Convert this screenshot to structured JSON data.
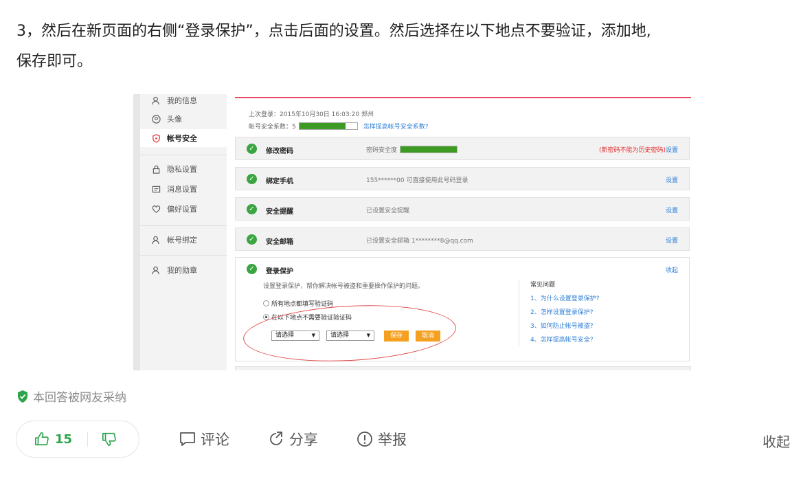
{
  "answer": {
    "line1": "3，然后在新页面的右侧“登录保护”，点击后面的设置。然后选择在以下地点不要验证，添加地,",
    "line2": "保存即可。"
  },
  "screenshot": {
    "sidebar": {
      "items": [
        {
          "label": "我的信息",
          "icon": "user-icon"
        },
        {
          "label": "头像",
          "icon": "avatar-icon"
        },
        {
          "label": "帐号安全",
          "icon": "shield-icon",
          "active": true
        },
        {
          "label": "隐私设置",
          "icon": "lock-icon"
        },
        {
          "label": "消息设置",
          "icon": "message-icon"
        },
        {
          "label": "偏好设置",
          "icon": "heart-icon"
        },
        {
          "label": "帐号绑定",
          "icon": "user-bind-icon"
        },
        {
          "label": "我的勋章",
          "icon": "medal-icon"
        }
      ]
    },
    "last_login": "上次登录：2015年10月30日  16:03:20  郑州",
    "security_label": "帐号安全系数：5",
    "security_level": 0.8,
    "security_link": "怎样提高帐号安全系数?",
    "rows": [
      {
        "name": "修改密码",
        "desc": "密码安全度",
        "warn": "(新密码不能为历史密码)",
        "action": "设置"
      },
      {
        "name": "绑定手机",
        "desc": "155******00 可直接使用此号码登录",
        "action": "设置"
      },
      {
        "name": "安全提醒",
        "desc": "已设置安全提醒",
        "action": "设置"
      },
      {
        "name": "安全邮箱",
        "desc": "已设置安全邮箱 1********8@qq.com",
        "action": "设置"
      }
    ],
    "login_protect": {
      "name": "登录保护",
      "collapse": "收起",
      "desc": "设置登录保护，帮你解决帐号被盗和重要操作保护的问题。",
      "radio1": "所有地点都填写验证码",
      "radio2": "在以下地点不需要验证验证码",
      "select1": "请选择",
      "select2": "请选择",
      "save": "保存",
      "cancel": "取消",
      "faq_title": "常见问题",
      "faq": [
        "1、为什么设置登录保护?",
        "2、怎样设置登录保护?",
        "3、如何防止帐号被盗?",
        "4、怎样提高帐号安全?"
      ]
    }
  },
  "adopted": "本回答被网友采纳",
  "vote": {
    "count": "15"
  },
  "actions": {
    "comment": "评论",
    "share": "分享",
    "report": "举报",
    "collapse": "收起"
  },
  "colors": {
    "accent_green": "#2ca44a",
    "check_green": "#3aa541",
    "link_blue": "#2f7fd6",
    "warn_red": "#e42f2f",
    "button_orange": "#f5a020"
  }
}
